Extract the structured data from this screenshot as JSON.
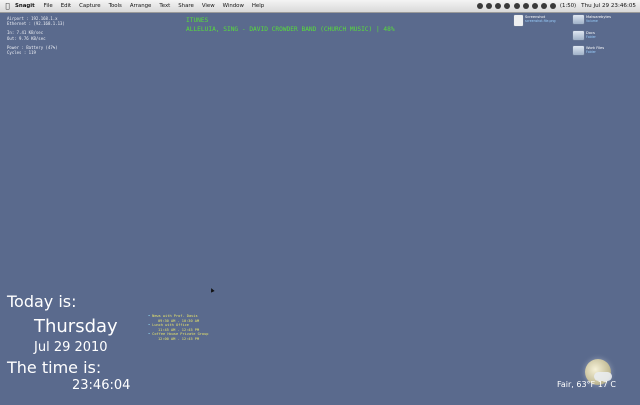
{
  "menubar": {
    "app": "Snagit",
    "items": [
      "File",
      "Edit",
      "Capture",
      "Tools",
      "Arrange",
      "Text",
      "Share",
      "View",
      "Window",
      "Help"
    ],
    "battery": "(1:50)",
    "clock": "Thu Jul 29  23:46:05"
  },
  "stats": {
    "lines_a": [
      "Airport : 192.168.1.x",
      "Ethernet : (92.168.1.13)"
    ],
    "lines_b": [
      "In: 7.41 KB/sec",
      "Out: 9.76 KB/sec"
    ],
    "lines_c": [
      "Power : Battery (47%)",
      "Cycles : 119"
    ]
  },
  "itunes": {
    "label": "ITUNES",
    "now_playing": "ALLELUIA, SING - DAVID CROWDER BAND (CHURCH MUSIC) | 48%"
  },
  "desktop_icons": [
    {
      "name": "Screenshot",
      "sub": "screenshot-file.png"
    },
    {
      "name": "Malwarebytes",
      "sub": "Volume"
    },
    {
      "name": "Docs",
      "sub": "Folder"
    },
    {
      "name": "Work Files",
      "sub": "Folder"
    }
  ],
  "datetime": {
    "today_label": "Today is:",
    "weekday": "Thursday",
    "date": "Jul 29 2010",
    "time_label": "The time is:",
    "time": "23:46:04"
  },
  "agenda": [
    {
      "title": "News with Prof. Davis",
      "time": "09:30 AM - 10:30 AM"
    },
    {
      "title": "Lunch with Office",
      "time": "11:45 AM - 12:45 PM"
    },
    {
      "title": "Coffee House Private Group",
      "time": "12:00 AM - 12:45 PM"
    }
  ],
  "weather": {
    "text": "Fair, 63°F   17 C",
    "icon": "moon-icon"
  }
}
